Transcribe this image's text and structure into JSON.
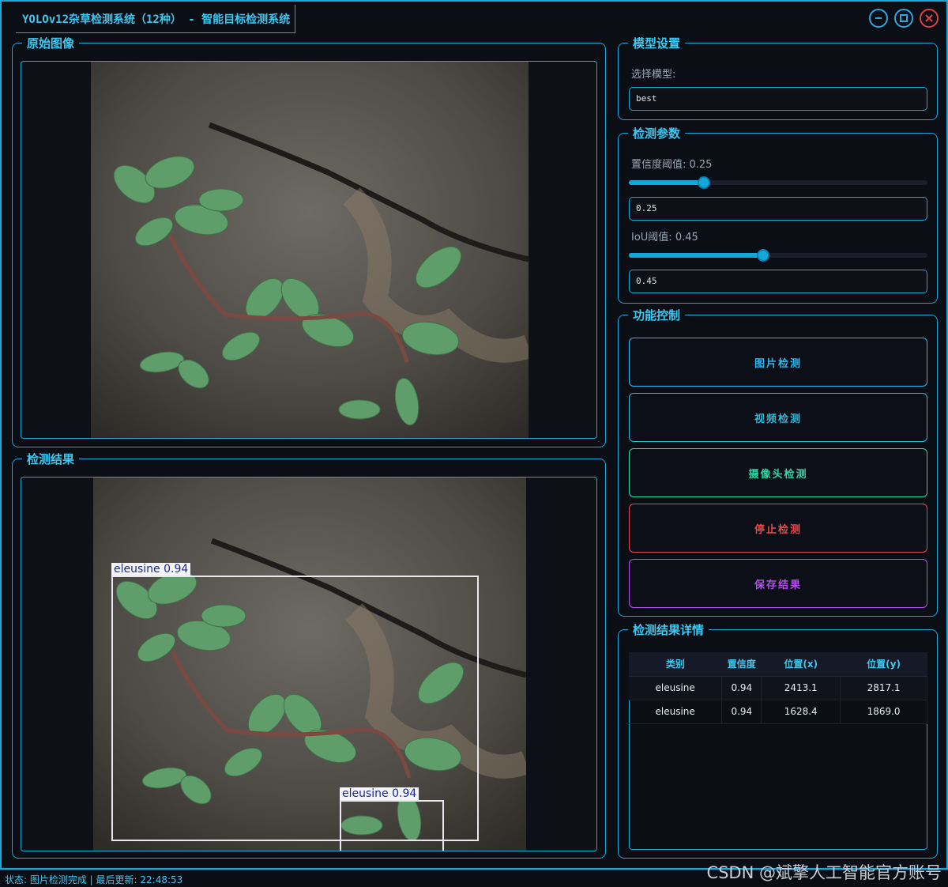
{
  "window": {
    "title": "YOLOv12杂草检测系统（12种） - 智能目标检测系统",
    "controls": [
      "minimize-icon",
      "maximize-icon",
      "close-icon"
    ]
  },
  "original_image": {
    "title": "原始图像"
  },
  "detection_result": {
    "title": "检测结果",
    "boxes": [
      {
        "label": "eleusine 0.94"
      },
      {
        "label": "eleusine 0.94"
      }
    ]
  },
  "model_settings": {
    "title": "模型设置",
    "select_label": "选择模型:",
    "selected_model": "best"
  },
  "params": {
    "title": "检测参数",
    "conf_label": "置信度阈值: 0.25",
    "conf_value": "0.25",
    "conf": 0.25,
    "iou_label": "IoU阈值: 0.45",
    "iou_value": "0.45",
    "iou": 0.45
  },
  "controls": {
    "title": "功能控制",
    "image_detect": "图片检测",
    "video_detect": "视频检测",
    "camera_detect": "摄像头检测",
    "stop_detect": "停止检测",
    "save_result": "保存结果",
    "colors": {
      "image": "#2ab8f0",
      "video": "#2ab8d8",
      "camera": "#2ad8a8",
      "stop": "#e84848",
      "save": "#b050e8"
    }
  },
  "details": {
    "title": "检测结果详情",
    "headers": [
      "类别",
      "置信度",
      "位置(x)",
      "位置(y)"
    ],
    "rows": [
      [
        "eleusine",
        "0.94",
        "2413.1",
        "2817.1"
      ],
      [
        "eleusine",
        "0.94",
        "1628.4",
        "1869.0"
      ]
    ]
  },
  "status": {
    "text": "状态: 图片检测完成 | 最后更新: 22:48:53",
    "watermark": "CSDN @斌擎人工智能官方账号"
  },
  "colors": {
    "accent": "#1aa8d8",
    "background": "#0c0e16"
  }
}
